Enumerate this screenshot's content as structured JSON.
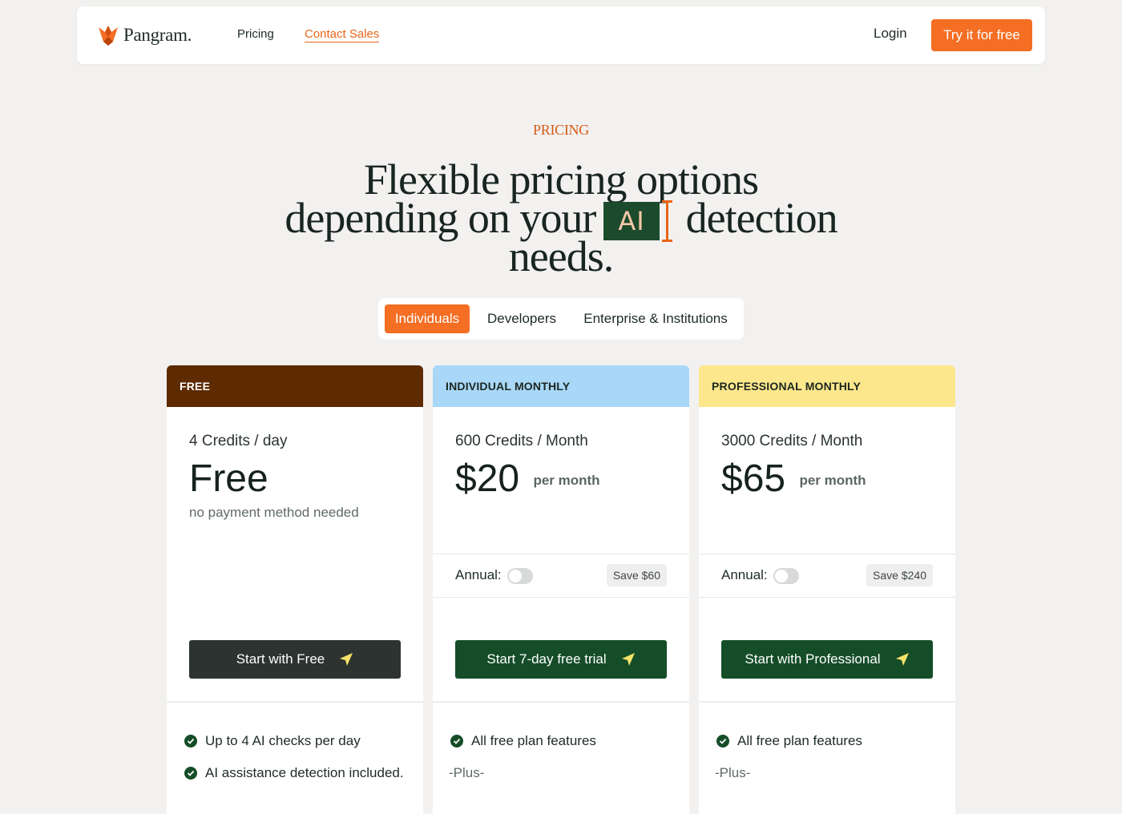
{
  "nav": {
    "logo_text": "Pangram.",
    "pricing": "Pricing",
    "contact_sales": "Contact Sales",
    "login": "Login",
    "try_free": "Try it for free",
    "accent": "#f46e23"
  },
  "hero": {
    "eyebrow": "PRICING",
    "line1": "Flexible pricing options",
    "line2_pre": "depending on your",
    "highlight": "AI",
    "line2_post": "detection",
    "line3": "needs."
  },
  "tabs": {
    "individuals": "Individuals",
    "developers": "Developers",
    "enterprise": "Enterprise & Institutions",
    "selected": "Individuals"
  },
  "plans": [
    {
      "name": "FREE",
      "credits": "4 Credits / day",
      "price": "Free",
      "note": "no payment method needed",
      "cta": "Start with Free",
      "features": [
        "Up to 4 AI checks per day",
        "AI assistance detection included."
      ],
      "header_color": "#5e2a02"
    },
    {
      "name": "INDIVIDUAL MONTHLY",
      "credits": "600 Credits / Month",
      "price": "$20",
      "per": "per month",
      "annual_label": "Annual:",
      "annual_on": false,
      "save": "Save $60",
      "cta": "Start 7-day free trial",
      "features": [
        "All free plan features"
      ],
      "plus": "-Plus-",
      "header_color": "#a9d7f7"
    },
    {
      "name": "PROFESSIONAL MONTHLY",
      "credits": "3000 Credits / Month",
      "price": "$65",
      "per": "per month",
      "annual_label": "Annual:",
      "annual_on": false,
      "save": "Save $240",
      "cta": "Start with Professional",
      "features": [
        "All free plan features"
      ],
      "plus": "-Plus-",
      "header_color": "#fde78c"
    }
  ]
}
